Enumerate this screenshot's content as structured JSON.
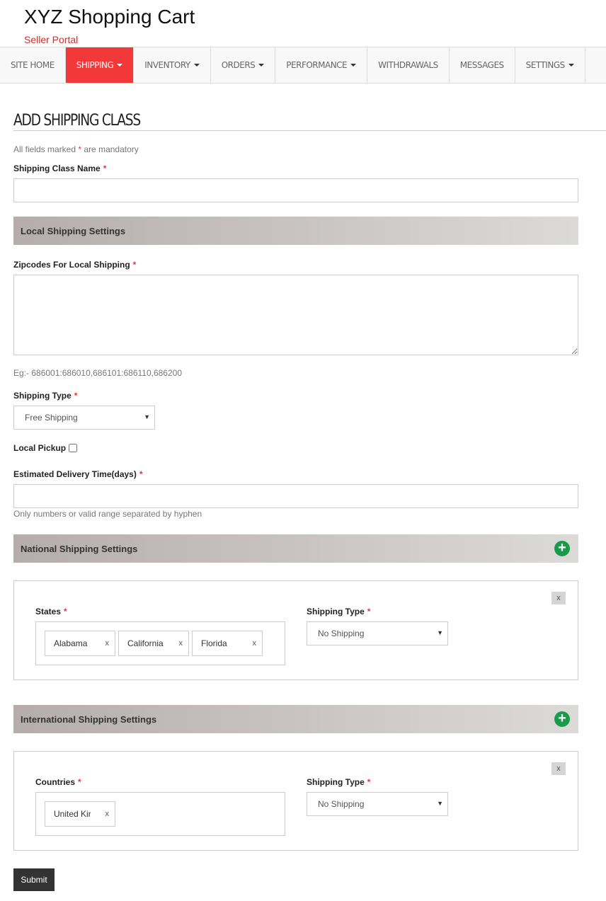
{
  "header": {
    "title": "XYZ Shopping Cart",
    "subtitle": "Seller Portal"
  },
  "nav": {
    "items": [
      {
        "label": "SITE HOME",
        "dropdown": false,
        "active": false
      },
      {
        "label": "SHIPPING",
        "dropdown": true,
        "active": true
      },
      {
        "label": "INVENTORY",
        "dropdown": true,
        "active": false
      },
      {
        "label": "ORDERS",
        "dropdown": true,
        "active": false
      },
      {
        "label": "PERFORMANCE",
        "dropdown": true,
        "active": false
      },
      {
        "label": "WITHDRAWALS",
        "dropdown": false,
        "active": false
      },
      {
        "label": "MESSAGES",
        "dropdown": false,
        "active": false
      },
      {
        "label": "SETTINGS",
        "dropdown": true,
        "active": false
      }
    ]
  },
  "page": {
    "heading": "ADD SHIPPING CLASS",
    "mandatory_pre": "All fields marked",
    "mandatory_star": "*",
    "mandatory_post": "are mandatory"
  },
  "form": {
    "class_name_label": "Shipping Class Name",
    "class_name_value": "",
    "local": {
      "title": "Local Shipping Settings",
      "zip_label": "Zipcodes For Local Shipping",
      "zip_value": "",
      "zip_hint": "Eg:- 686001:686010,686101:686110,686200",
      "shipping_type_label": "Shipping Type",
      "shipping_type_value": "Free Shipping",
      "pickup_label": "Local Pickup",
      "pickup_checked": false,
      "delivery_label": "Estimated Delivery Time(days)",
      "delivery_value": "",
      "delivery_hint": "Only numbers or valid range separated by hyphen"
    },
    "national": {
      "title": "National Shipping Settings",
      "states_label": "States",
      "states": [
        "Alabama",
        "California",
        "Florida"
      ],
      "shipping_type_label": "Shipping Type",
      "shipping_type_value": "No Shipping",
      "remove": "x"
    },
    "international": {
      "title": "International Shipping Settings",
      "countries_label": "Countries",
      "countries": [
        "United Kir"
      ],
      "shipping_type_label": "Shipping Type",
      "shipping_type_value": "No Shipping",
      "remove": "x"
    },
    "tag_remove": "x",
    "required": "*",
    "submit": "Submit"
  },
  "colors": {
    "active_nav": "#f23838",
    "subtitle": "#c9302c",
    "add_icon": "#1a9b4c"
  }
}
